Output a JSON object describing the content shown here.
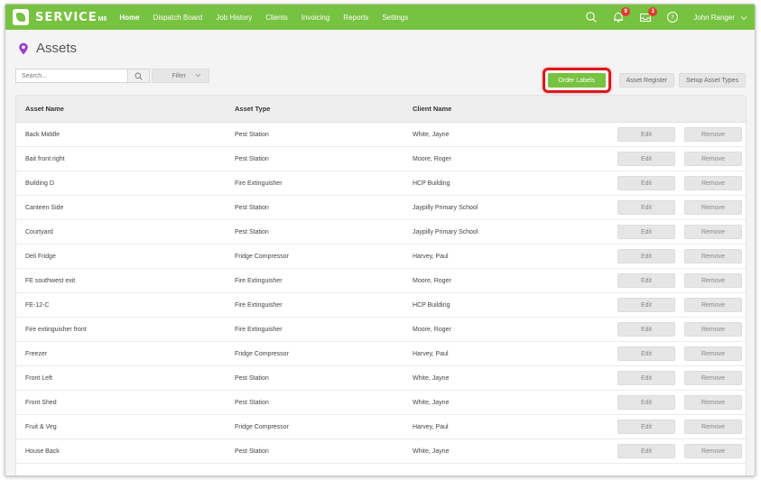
{
  "brand": {
    "name": "SERVICE",
    "suffix": "M8"
  },
  "nav": [
    {
      "label": "Home"
    },
    {
      "label": "Dispatch Board"
    },
    {
      "label": "Job History"
    },
    {
      "label": "Clients"
    },
    {
      "label": "Invoicing"
    },
    {
      "label": "Reports"
    },
    {
      "label": "Settings"
    }
  ],
  "header_right": {
    "notifications_badge": "9",
    "messages_badge": "3",
    "user_name": "John Ranger"
  },
  "page": {
    "title": "Assets"
  },
  "search": {
    "placeholder": "Search..."
  },
  "filter": {
    "label": "Filter"
  },
  "actions": {
    "order_labels": "Order Labels",
    "asset_register": "Asset Register",
    "setup_asset_types": "Setup Asset Types"
  },
  "table": {
    "headers": [
      "Asset Name",
      "Asset Type",
      "Client Name"
    ],
    "edit_label": "Edit",
    "remove_label": "Remove",
    "rows": [
      {
        "name": "Back Middle",
        "type": "Pest Station",
        "client": "White, Jayne"
      },
      {
        "name": "Bait front right",
        "type": "Pest Station",
        "client": "Moore, Roger"
      },
      {
        "name": "Building D",
        "type": "Fire Extinguisher",
        "client": "HCP Building"
      },
      {
        "name": "Canteen Side",
        "type": "Pest Station",
        "client": "Jaypilly Primary School"
      },
      {
        "name": "Courtyard",
        "type": "Pest Station",
        "client": "Jaypilly Primary School"
      },
      {
        "name": "Deli Fridge",
        "type": "Fridge Compressor",
        "client": "Harvey, Paul"
      },
      {
        "name": "FE southwest exit",
        "type": "Fire Extinguisher",
        "client": "Moore, Roger"
      },
      {
        "name": "FE-12-C",
        "type": "Fire Extinguisher",
        "client": "HCP Building"
      },
      {
        "name": "Fire extinguisher front",
        "type": "Fire Extinguisher",
        "client": "Moore, Roger"
      },
      {
        "name": "Freezer",
        "type": "Fridge Compressor",
        "client": "Harvey, Paul"
      },
      {
        "name": "Front Left",
        "type": "Pest Station",
        "client": "White, Jayne"
      },
      {
        "name": "Front Shed",
        "type": "Pest Station",
        "client": "White, Jayne"
      },
      {
        "name": "Fruit & Veg",
        "type": "Fridge Compressor",
        "client": "Harvey, Paul"
      },
      {
        "name": "House Back",
        "type": "Pest Station",
        "client": "White, Jayne"
      }
    ]
  },
  "colors": {
    "brand_green": "#77c240",
    "highlight_red": "#d9191c",
    "badge_red": "#e03a2f",
    "pin_purple": "#9b3fd0"
  },
  "icons": [
    "search-icon",
    "bell-icon",
    "inbox-icon",
    "help-icon",
    "chevron-down-icon",
    "location-pin-icon"
  ]
}
